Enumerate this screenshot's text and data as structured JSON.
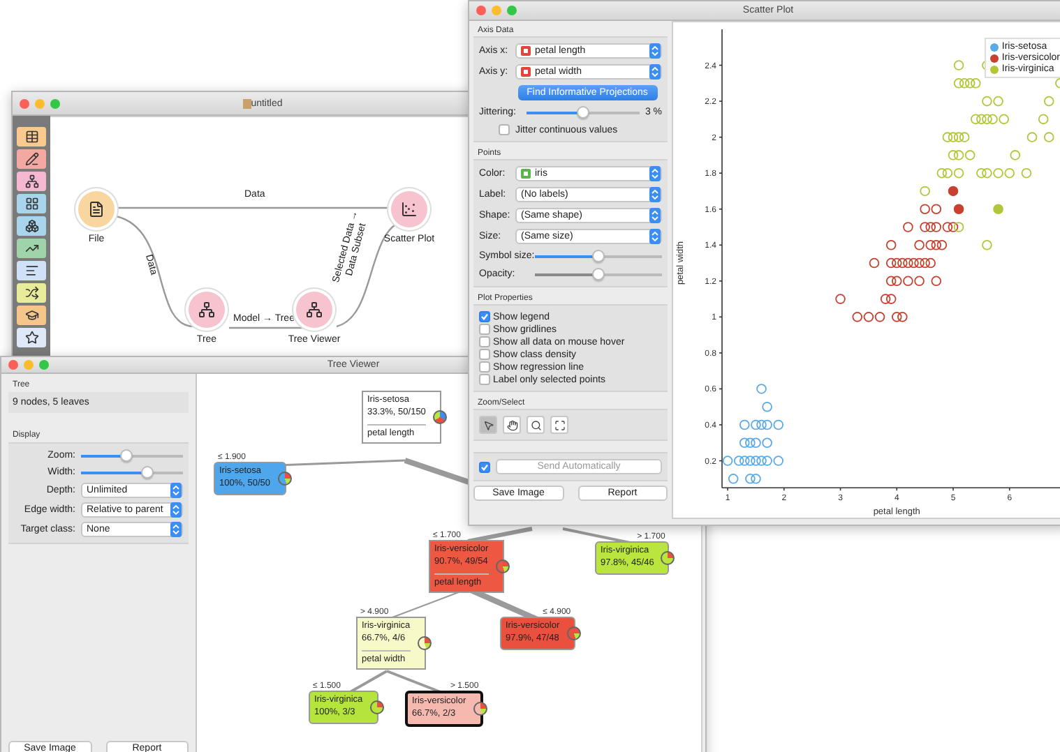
{
  "workflow_window": {
    "title": "untitled",
    "nodes": [
      {
        "label": "File",
        "color": "#f9d6a0"
      },
      {
        "label": "Tree",
        "color": "#f6c3cf"
      },
      {
        "label": "Tree Viewer",
        "color": "#f6c3cf"
      },
      {
        "label": "Scatter Plot",
        "color": "#f6c3cf"
      }
    ],
    "links": [
      {
        "label": "Data"
      },
      {
        "label": "Data"
      },
      {
        "label": "Model → Tree"
      },
      {
        "label": "Selected Data → Data Subset"
      }
    ]
  },
  "tree_viewer": {
    "title": "Tree Viewer",
    "info_title": "Tree",
    "info": "9 nodes, 5 leaves",
    "display_title": "Display",
    "sliders": [
      {
        "label": "Zoom:",
        "level": 0.45
      },
      {
        "label": "Width:",
        "level": 0.65
      }
    ],
    "selects": [
      {
        "label": "Depth:",
        "value": "Unlimited"
      },
      {
        "label": "Edge width:",
        "value": "Relative to parent"
      },
      {
        "label": "Target class:",
        "value": "None"
      }
    ],
    "buttons": [
      "Save Image",
      "Report"
    ],
    "tree": [
      {
        "class": "Iris-setosa",
        "stats": "33.3%, 50/150",
        "split": "petal length",
        "color": "#ffffff",
        "selected": false,
        "children": [
          {
            "condition": "≤ 1.900",
            "class": "Iris-setosa",
            "stats": "100%, 50/50",
            "color": "#4ea7ec",
            "selected": false
          }
        ]
      },
      {
        "condition": "≤ 1.700",
        "class": "Iris-versicolor",
        "stats": "90.7%, 49/54",
        "split": "petal length",
        "color": "#ec5842",
        "selected": false,
        "children": [
          {
            "condition": "> 4.900",
            "class": "Iris-virginica",
            "stats": "66.7%, 4/6",
            "split": "petal width",
            "color": "#f7f9c9",
            "selected": false,
            "children": [
              {
                "condition": "≤ 1.500",
                "class": "Iris-virginica",
                "stats": "100%, 3/3",
                "color": "#b5e43c",
                "selected": false
              },
              {
                "condition": "> 1.500",
                "class": "Iris-versicolor",
                "stats": "66.7%, 2/3",
                "color": "#f6b9b0",
                "selected": true
              }
            ]
          },
          {
            "condition": "≤ 4.900",
            "class": "Iris-versicolor",
            "stats": "97.9%, 47/48",
            "color": "#e9513e",
            "selected": false
          }
        ]
      },
      {
        "condition": "> 1.700",
        "class": "Iris-virginica",
        "stats": "97.8%, 45/46",
        "color": "#b9e53e",
        "selected": false
      }
    ]
  },
  "scatter_window": {
    "title": "Scatter Plot",
    "axis_data": {
      "title": "Axis Data",
      "selects": [
        {
          "label": "Axis x:",
          "value": "petal length",
          "kind": "continuous"
        },
        {
          "label": "Axis y:",
          "value": "petal width",
          "kind": "continuous"
        }
      ],
      "find_button": "Find Informative Projections",
      "jittering": {
        "label": "Jittering:",
        "level": 0.5,
        "reading": "3 %"
      },
      "jitter_continuous": {
        "label": "Jitter continuous values",
        "checked": false
      }
    },
    "points": {
      "title": "Points",
      "selects": [
        {
          "label": "Color:",
          "value": "iris",
          "kind": "discrete"
        },
        {
          "label": "Label:",
          "value": "(No labels)"
        },
        {
          "label": "Shape:",
          "value": "(Same shape)"
        },
        {
          "label": "Size:",
          "value": "(Same size)"
        }
      ],
      "sliders": [
        {
          "label": "Symbol size:",
          "level": 0.5,
          "disabled": false
        },
        {
          "label": "Opacity:",
          "level": 0.5,
          "disabled": true
        }
      ]
    },
    "plot_properties": {
      "title": "Plot Properties",
      "options": [
        {
          "label": "Show legend",
          "checked": true
        },
        {
          "label": "Show gridlines",
          "checked": false
        },
        {
          "label": "Show all data on mouse hover",
          "checked": false
        },
        {
          "label": "Show class density",
          "checked": false
        },
        {
          "label": "Show regression line",
          "checked": false
        },
        {
          "label": "Label only selected points",
          "checked": false
        }
      ]
    },
    "zoom_select": {
      "title": "Zoom/Select",
      "tools": [
        {
          "selected": true
        },
        {
          "selected": false
        },
        {
          "selected": false
        },
        {
          "selected": false
        }
      ]
    },
    "send": {
      "checked": true,
      "label": "Send Automatically",
      "disabled": true
    },
    "buttons": [
      "Save Image",
      "Report"
    ],
    "point_selection": [
      [
        false,
        false,
        false,
        false,
        false,
        false,
        false,
        false,
        false,
        false,
        false,
        false,
        false,
        false,
        false,
        false,
        false,
        false,
        false,
        false,
        false,
        false
      ],
      [
        false,
        false,
        false,
        false,
        false,
        false,
        false,
        false,
        false,
        false,
        false,
        false,
        false,
        false,
        false,
        false,
        false,
        false,
        false,
        false,
        false,
        false,
        false,
        false,
        false,
        false,
        false,
        false,
        false,
        false,
        false,
        false,
        false,
        false,
        false,
        true,
        true
      ],
      [
        false,
        false,
        true,
        false,
        false,
        false,
        false,
        false,
        false,
        false,
        false,
        false,
        false,
        false,
        false,
        false,
        false,
        false,
        false,
        false,
        false,
        false,
        false,
        false,
        false,
        false,
        false,
        false,
        false,
        false,
        false,
        false,
        false,
        false,
        false,
        false,
        false,
        false
      ]
    ],
    "chart_data": {
      "type": "scatter",
      "xlabel": "petal length",
      "ylabel": "petal width",
      "xlim": [
        0.9,
        6.92
      ],
      "ylim": [
        0.05,
        2.6
      ],
      "xticks": [
        1,
        2,
        3,
        4,
        5,
        6
      ],
      "yticks": [
        0.2,
        0.4,
        0.6,
        0.8,
        1,
        1.2,
        1.4,
        1.6,
        1.8,
        2,
        2.2,
        2.4
      ],
      "series": [
        {
          "name": "Iris-setosa",
          "color": "#5aaae6",
          "x": [
            1.1,
            1.4,
            1.5,
            1.0,
            1.2,
            1.3,
            1.4,
            1.5,
            1.6,
            1.7,
            1.9,
            1.3,
            1.4,
            1.5,
            1.7,
            1.3,
            1.5,
            1.6,
            1.7,
            1.9,
            1.7,
            1.6
          ],
          "values": [
            0.1,
            0.1,
            0.1,
            0.2,
            0.2,
            0.2,
            0.2,
            0.2,
            0.2,
            0.2,
            0.2,
            0.3,
            0.3,
            0.3,
            0.3,
            0.4,
            0.4,
            0.4,
            0.4,
            0.4,
            0.5,
            0.6
          ]
        },
        {
          "name": "Iris-versicolor",
          "color": "#c8402f",
          "x": [
            3.3,
            3.5,
            3.7,
            4.0,
            4.1,
            3.0,
            3.8,
            3.9,
            3.9,
            4.0,
            4.2,
            4.4,
            4.7,
            3.6,
            3.9,
            4.0,
            4.1,
            4.2,
            4.3,
            4.4,
            4.5,
            4.6,
            3.9,
            4.4,
            4.6,
            4.7,
            4.8,
            4.2,
            4.5,
            4.6,
            4.7,
            4.9,
            5.0,
            4.5,
            4.7,
            5.1,
            5.0
          ],
          "values": [
            1.0,
            1.0,
            1.0,
            1.0,
            1.0,
            1.1,
            1.1,
            1.1,
            1.2,
            1.2,
            1.2,
            1.2,
            1.2,
            1.3,
            1.3,
            1.3,
            1.3,
            1.3,
            1.3,
            1.3,
            1.3,
            1.3,
            1.4,
            1.4,
            1.4,
            1.4,
            1.4,
            1.5,
            1.5,
            1.5,
            1.5,
            1.5,
            1.5,
            1.6,
            1.6,
            1.6,
            1.7
          ]
        },
        {
          "name": "Iris-virginica",
          "color": "#b3c63a",
          "x": [
            5.6,
            5.1,
            5.8,
            4.5,
            4.8,
            4.9,
            5.1,
            5.5,
            5.6,
            5.8,
            6.0,
            6.3,
            5.0,
            5.1,
            5.3,
            6.1,
            4.9,
            5.0,
            5.1,
            5.2,
            6.4,
            6.7,
            5.4,
            5.5,
            5.6,
            5.7,
            5.9,
            6.6,
            5.6,
            5.8,
            6.7,
            5.1,
            5.2,
            5.3,
            5.4,
            6.9,
            5.1,
            5.6
          ],
          "values": [
            1.4,
            1.5,
            1.6,
            1.7,
            1.8,
            1.8,
            1.8,
            1.8,
            1.8,
            1.8,
            1.8,
            1.8,
            1.9,
            1.9,
            1.9,
            1.9,
            2.0,
            2.0,
            2.0,
            2.0,
            2.0,
            2.0,
            2.1,
            2.1,
            2.1,
            2.1,
            2.1,
            2.1,
            2.2,
            2.2,
            2.2,
            2.3,
            2.3,
            2.3,
            2.3,
            2.3,
            2.4,
            2.4
          ]
        }
      ]
    }
  }
}
